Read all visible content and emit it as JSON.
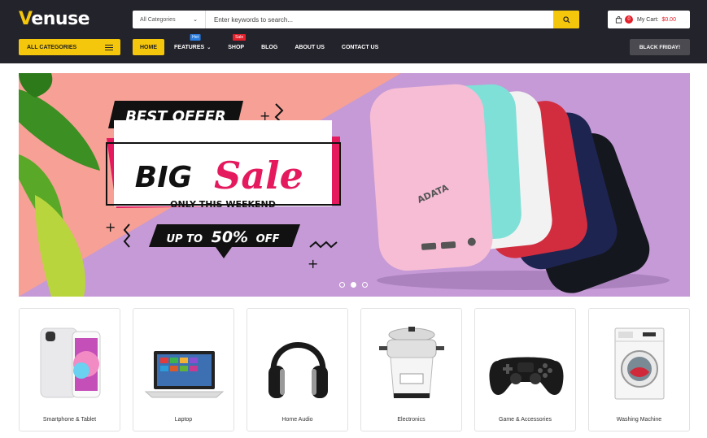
{
  "brand": {
    "logo_first": "V",
    "logo_rest": "enuse",
    "accent": "#f5c70c"
  },
  "search": {
    "category_label": "All Categories",
    "placeholder": "Enter keywords to search..."
  },
  "cart": {
    "count": "0",
    "label": "My Cart:",
    "total": "$0.00"
  },
  "nav": {
    "all_categories": "ALL CATEGORIES",
    "items": [
      {
        "label": "HOME",
        "tag": ""
      },
      {
        "label": "FEATURES",
        "tag": "Hot"
      },
      {
        "label": "SHOP",
        "tag": "Sale"
      },
      {
        "label": "BLOG",
        "tag": ""
      },
      {
        "label": "ABOUT US",
        "tag": ""
      },
      {
        "label": "CONTACT US",
        "tag": ""
      }
    ],
    "promo_button": "BLACK FRIDAY!"
  },
  "banner": {
    "best_offer": "BEST OFFER",
    "big": "BIG",
    "sale": "Sale",
    "only_this_weekend": "ONLY THIS WEEKEND",
    "up_to": "UP TO",
    "percent": "50%",
    "off": "OFF",
    "product_brand": "ADATA",
    "slides": 3,
    "active_slide": 2
  },
  "categories": [
    {
      "label": "Smartphone & Tablet",
      "icon": "smartphone-icon"
    },
    {
      "label": "Laptop",
      "icon": "laptop-icon"
    },
    {
      "label": "Home Audio",
      "icon": "headphones-icon"
    },
    {
      "label": "Electronics",
      "icon": "rice-cooker-icon"
    },
    {
      "label": "Game & Accessories",
      "icon": "gamepad-icon"
    },
    {
      "label": "Washing Machine",
      "icon": "washing-machine-icon"
    }
  ]
}
